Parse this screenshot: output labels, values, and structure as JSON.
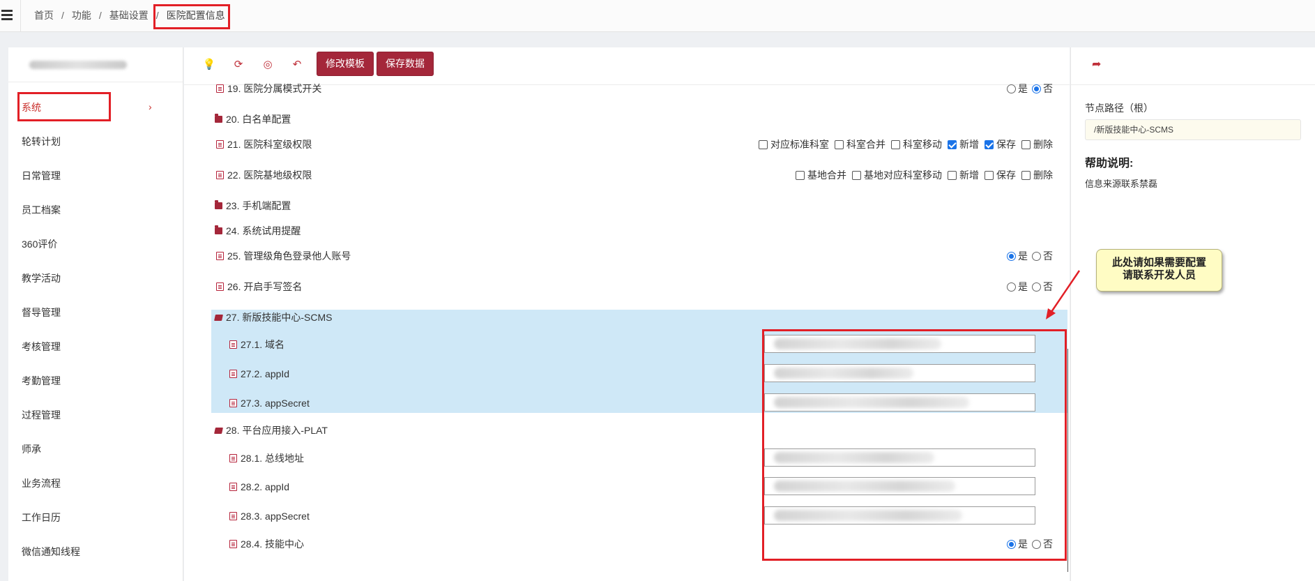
{
  "breadcrumb": {
    "items": [
      "首页",
      "功能",
      "基础设置"
    ],
    "separator": "/",
    "current": "医院配置信息"
  },
  "sidebar": {
    "items": [
      "系统",
      "轮转计划",
      "日常管理",
      "员工档案",
      "360评价",
      "教学活动",
      "督导管理",
      "考核管理",
      "考勤管理",
      "过程管理",
      "师承",
      "业务流程",
      "工作日历",
      "微信通知线程"
    ],
    "active_chevron": "›"
  },
  "toolbar": {
    "icons": [
      "lightbulb-icon",
      "refresh-icon",
      "eye-slash-icon",
      "undo-icon"
    ],
    "edit_template": "修改模板",
    "save_data": "保存数据"
  },
  "tree": {
    "row19": "19. 医院分属模式开关",
    "row20": "20. 白名单配置",
    "row21": "21. 医院科室级权限",
    "row21_opts": [
      "对应标准科室",
      "科室合并",
      "科室移动",
      "新增",
      "保存",
      "删除"
    ],
    "row22": "22. 医院基地级权限",
    "row22_opts": [
      "基地合并",
      "基地对应科室移动",
      "新增",
      "保存",
      "删除"
    ],
    "row23": "23. 手机端配置",
    "row24": "24. 系统试用提醒",
    "row25": "25. 管理级角色登录他人账号",
    "row26": "26. 开启手写签名",
    "row27": "27. 新版技能中心-SCMS",
    "row27_1": "27.1. 域名",
    "row27_2": "27.2. appId",
    "row27_3": "27.3. appSecret",
    "row28": "28. 平台应用接入-PLAT",
    "row28_1": "28.1. 总线地址",
    "row28_2": "28.2. appId",
    "row28_3": "28.3. appSecret",
    "row28_4": "28.4. 技能中心",
    "yes": "是",
    "no": "否"
  },
  "right_panel": {
    "node_path_label": "节点路径（根）",
    "node_path_value": "/新版技能中心-SCMS",
    "help_title": "帮助说明:",
    "help_text": "信息来源联系禁磊"
  },
  "callout": {
    "line1": "此处请如果需要配置",
    "line2": "请联系开发人员"
  },
  "colors": {
    "accent": "#a4273a",
    "highlight": "#e21f26",
    "selection": "#cfe8f7",
    "check": "#1a73e8"
  }
}
